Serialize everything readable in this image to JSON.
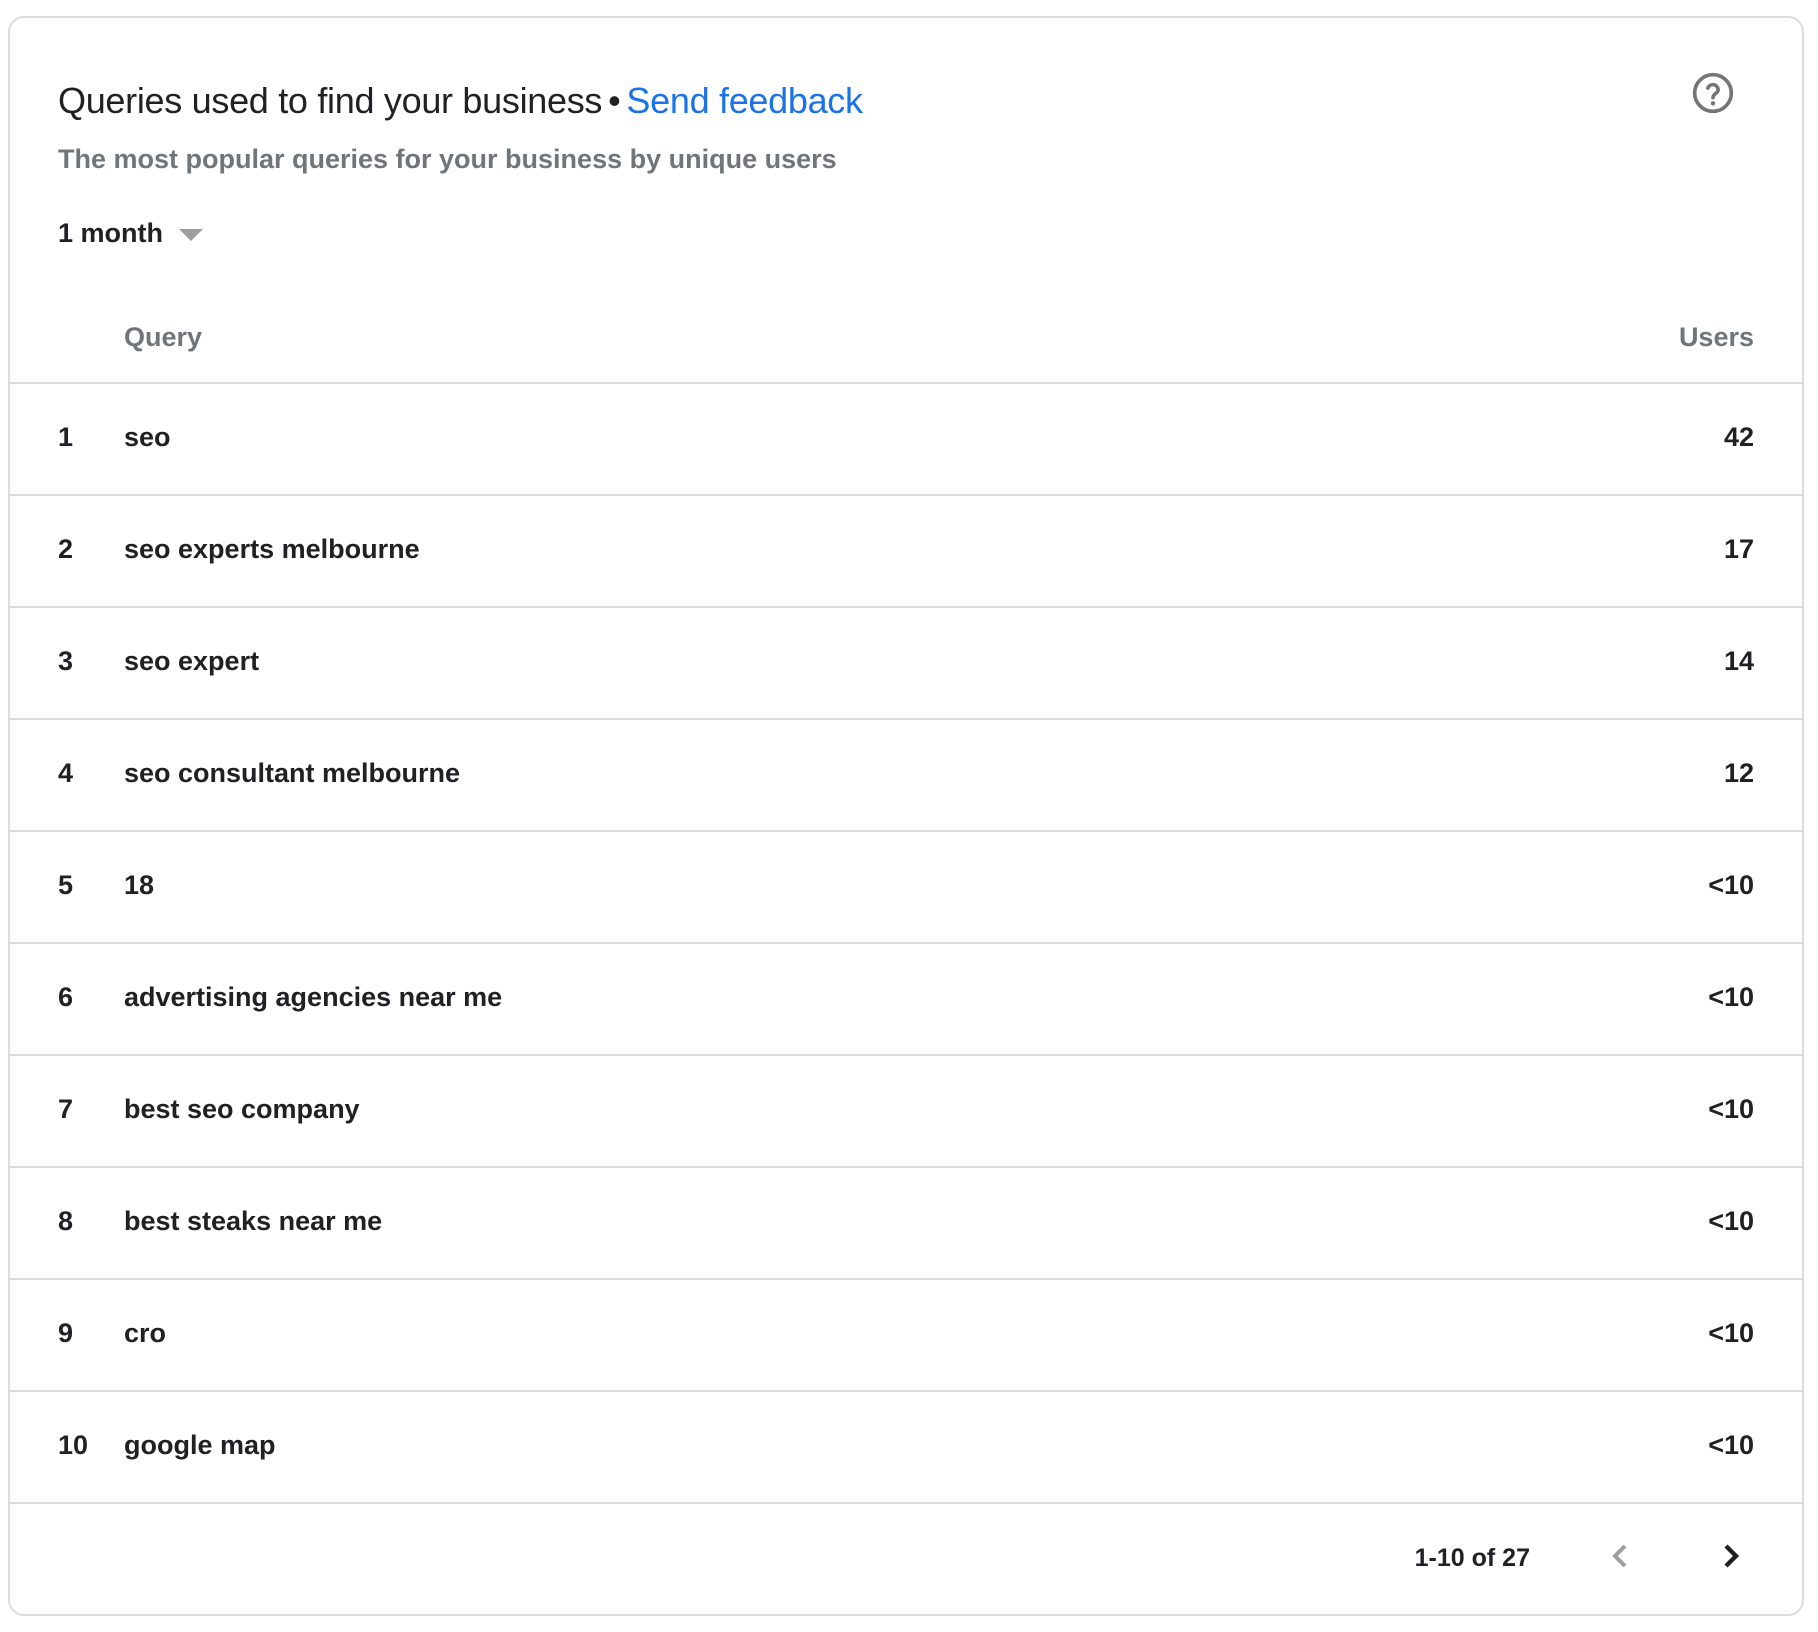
{
  "header": {
    "title": "Queries used to find your business",
    "separator": "•",
    "feedback_link": "Send feedback",
    "subtitle": "The most popular queries for your business by unique users",
    "help_icon": "help-circle-icon"
  },
  "range_select": {
    "selected": "1 month",
    "icon": "dropdown-caret-icon"
  },
  "table": {
    "columns": [
      "Query",
      "Users"
    ],
    "rows": [
      {
        "rank": "1",
        "query": "seo",
        "users": "42"
      },
      {
        "rank": "2",
        "query": "seo experts melbourne",
        "users": "17"
      },
      {
        "rank": "3",
        "query": "seo expert",
        "users": "14"
      },
      {
        "rank": "4",
        "query": "seo consultant melbourne",
        "users": "12"
      },
      {
        "rank": "5",
        "query": "18",
        "users": "<10"
      },
      {
        "rank": "6",
        "query": "advertising agencies near me",
        "users": "<10"
      },
      {
        "rank": "7",
        "query": "best seo company",
        "users": "<10"
      },
      {
        "rank": "8",
        "query": "best steaks near me",
        "users": "<10"
      },
      {
        "rank": "9",
        "query": "cro",
        "users": "<10"
      },
      {
        "rank": "10",
        "query": "google map",
        "users": "<10"
      }
    ]
  },
  "pagination": {
    "label": "1-10 of 27",
    "prev_icon": "chevron-left-icon",
    "next_icon": "chevron-right-icon",
    "prev_enabled": false,
    "next_enabled": true
  },
  "colors": {
    "link": "#1a73e8",
    "text": "#202124",
    "secondary_text": "#70757a",
    "divider": "#dadce0",
    "disabled_icon": "#9e9e9e"
  }
}
